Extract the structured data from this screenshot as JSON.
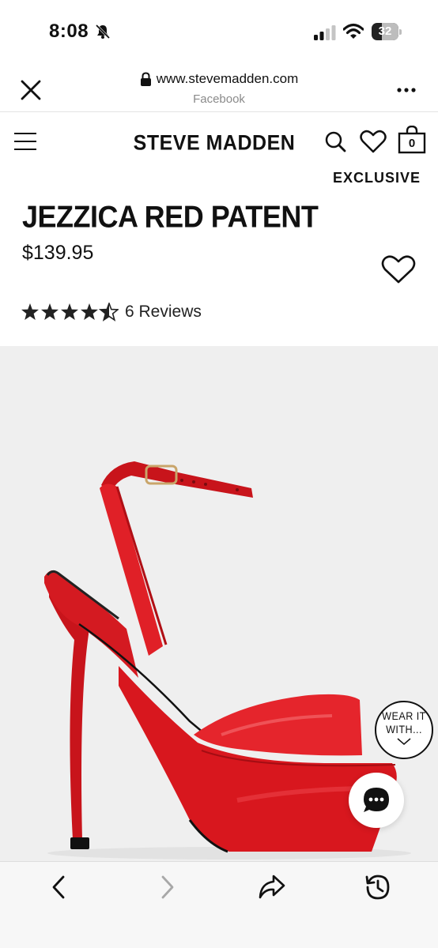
{
  "status_bar": {
    "time": "8:08",
    "battery": "32"
  },
  "browser": {
    "url": "www.stevemadden.com",
    "source": "Facebook"
  },
  "site": {
    "brand": "STEVE MADDEN",
    "cart_count": "0"
  },
  "product": {
    "badge": "EXCLUSIVE",
    "title": "JEZZICA RED PATENT",
    "price": "$139.95",
    "rating": 4.5,
    "reviews_label": "6 Reviews"
  },
  "wear_it": {
    "line1": "WEAR IT",
    "line2": "WITH..."
  },
  "colors": {
    "shoe": "#d9181f",
    "image_bg": "#efefef",
    "text": "#111111"
  },
  "icons": [
    "bell-slash-icon",
    "signal-icon",
    "wifi-icon",
    "close-icon",
    "lock-icon",
    "more-icon",
    "menu-icon",
    "search-icon",
    "heart-icon",
    "cart-icon",
    "star-icon",
    "chat-icon",
    "back-icon",
    "forward-icon",
    "share-icon",
    "history-icon"
  ]
}
